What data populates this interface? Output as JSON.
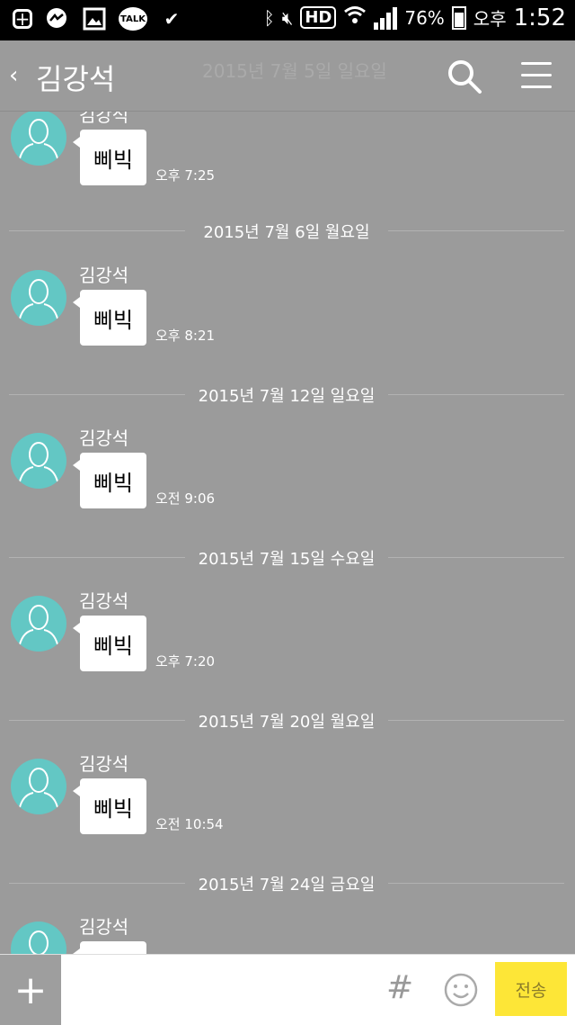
{
  "status_bar": {
    "icons": [
      "plus-square-icon",
      "messenger-icon",
      "gallery-icon",
      "kakaotalk-icon",
      "check-icon",
      "bluetooth-icon",
      "mute-icon",
      "hd-icon",
      "wifi-icon",
      "signal-icon",
      "battery-icon"
    ],
    "talk_label": "TALK",
    "hd_label": "HD",
    "battery": "76%",
    "ampm": "오후",
    "time": "1:52"
  },
  "header": {
    "back": "‹",
    "title": "김강석",
    "faded_date": "2015년 7월 5일 일요일"
  },
  "messages": [
    {
      "sender": "김강석",
      "text": "삐빅",
      "time": "오후 7:25"
    },
    {
      "sender": "김강석",
      "text": "삐빅",
      "time": "오후 8:21"
    },
    {
      "sender": "김강석",
      "text": "삐빅",
      "time": "오전 9:06"
    },
    {
      "sender": "김강석",
      "text": "삐빅",
      "time": "오후 7:20"
    },
    {
      "sender": "김강석",
      "text": "삐빅",
      "time": "오전 10:54"
    },
    {
      "sender": "김강석",
      "text": "",
      "time": ""
    }
  ],
  "dividers": [
    "2015년 7월 6일 월요일",
    "2015년 7월 12일 일요일",
    "2015년 7월 15일 수요일",
    "2015년 7월 20일 월요일",
    "2015년 7월 24일 금요일"
  ],
  "input_bar": {
    "plus": "+",
    "hash": "#",
    "send": "전송"
  },
  "colors": {
    "background": "#9b9b9b",
    "avatar": "#63c7c4",
    "send_button": "#fde637"
  }
}
